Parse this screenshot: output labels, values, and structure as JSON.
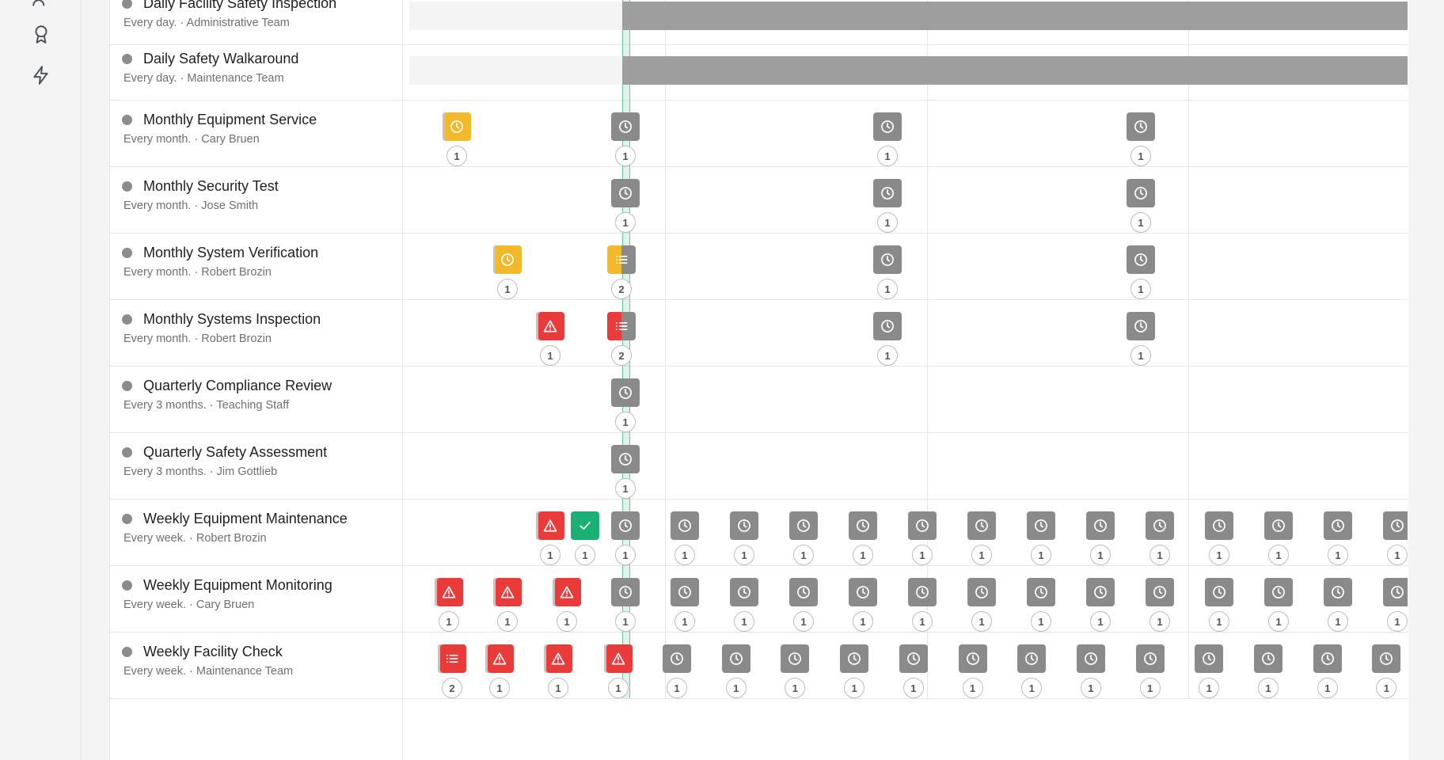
{
  "sidebar": {
    "icons": [
      {
        "name": "users-icon"
      },
      {
        "name": "award-icon"
      },
      {
        "name": "lightning-icon"
      }
    ]
  },
  "rows": [
    {
      "title": "Daily Facility Safety Inspection",
      "frequency": "Every day.",
      "assignee": "· Administrative Team"
    },
    {
      "title": "Daily Safety Walkaround",
      "frequency": "Every day.",
      "assignee": "· Maintenance Team"
    },
    {
      "title": "Monthly Equipment Service",
      "frequency": "Every month.",
      "assignee": "· Cary Bruen"
    },
    {
      "title": "Monthly Security Test",
      "frequency": "Every month.",
      "assignee": "· Jose Smith"
    },
    {
      "title": "Monthly System Verification",
      "frequency": "Every month.",
      "assignee": "· Robert Brozin"
    },
    {
      "title": "Monthly Systems Inspection",
      "frequency": "Every month.",
      "assignee": "· Robert Brozin"
    },
    {
      "title": "Quarterly Compliance Review",
      "frequency": "Every 3 months.",
      "assignee": "· Teaching Staff"
    },
    {
      "title": "Quarterly Safety Assessment",
      "frequency": "Every 3 months.",
      "assignee": "· Jim Gottlieb"
    },
    {
      "title": "Weekly Equipment Maintenance",
      "frequency": "Every week.",
      "assignee": "· Robert Brozin"
    },
    {
      "title": "Weekly Equipment Monitoring",
      "frequency": "Every week.",
      "assignee": "· Cary Bruen"
    },
    {
      "title": "Weekly Facility Check",
      "frequency": "Every week.",
      "assignee": "· Maintenance Team"
    }
  ],
  "colors": {
    "scheduled": "#8a8a8a",
    "pending": "#f2b92b",
    "overdue": "#ea3b3b",
    "completed": "#1aaf73",
    "today_line": "#6bc79a"
  },
  "count_labels": {
    "one": "1",
    "two": "2"
  }
}
